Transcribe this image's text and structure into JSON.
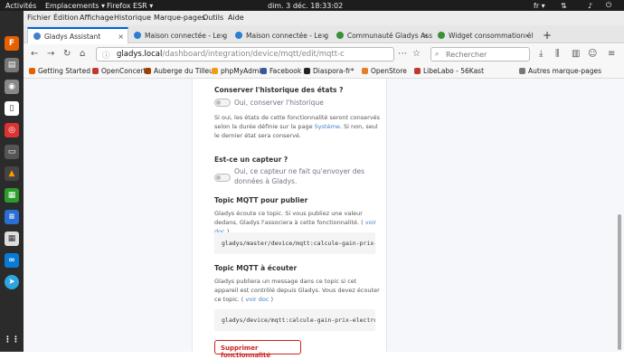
{
  "system": {
    "activities": "Activités",
    "places": "Emplacements ▾",
    "app": "Firefox ESR ▾",
    "clock": "dim. 3 déc. 18:33:02",
    "lang": "fr ▾"
  },
  "menu": [
    "Fichier",
    "Édition",
    "Affichage",
    "Historique",
    "Marque-pages",
    "Outils",
    "Aide"
  ],
  "tabs": [
    {
      "label": "Gladys Assistant",
      "active": true
    },
    {
      "label": "Maison connectée - Le g",
      "active": false
    },
    {
      "label": "Maison connectée - Le g",
      "active": false
    },
    {
      "label": "Communauté Gladys Ass",
      "active": false
    },
    {
      "label": "Widget consommation él",
      "active": false
    }
  ],
  "url": {
    "host": "gladys.local",
    "path": "/dashboard/integration/device/mqtt/edit/mqtt-c"
  },
  "search_placeholder": "Rechercher",
  "bookmarks": [
    {
      "label": "Getting Started",
      "color": "#e66000"
    },
    {
      "label": "OpenConcerto",
      "color": "#c0392b"
    },
    {
      "label": "Auberge du Tilleul",
      "color": "#a04000"
    },
    {
      "label": "phpMyAdmin",
      "color": "#f39c12"
    },
    {
      "label": "Facebook",
      "color": "#3b5998"
    },
    {
      "label": "Diaspora-fr*",
      "color": "#222"
    },
    {
      "label": "OpenStore",
      "color": "#e67e22"
    },
    {
      "label": "LibeLabo - 56Kast",
      "color": "#c0392b"
    },
    {
      "label": "Autres marque-pages",
      "color": "#777"
    }
  ],
  "form": {
    "history_title": "Conserver l'historique des états ?",
    "history_toggle": "Oui, conserver l'historique",
    "history_help_1": "Si oui, les états de cette fonctionnalité seront conservés selon la durée définie sur la page",
    "history_link": "Système",
    "history_help_2": ". Si non, seul le dernier état sera conservé.",
    "sensor_title": "Est-ce un capteur ?",
    "sensor_toggle": "Oui, ce capteur ne fait qu'envoyer des données à Gladys.",
    "publish_title": "Topic MQTT pour publier",
    "publish_help": "Gladys écoute ce topic. Si vous publiez une valeur dedans, Gladys l'associera à cette fonctionnalité. (",
    "publish_link": "voir doc",
    "publish_help_end": " )",
    "publish_topic": "gladys/master/device/mqtt:calcule-gain-prix-",
    "listen_title": "Topic MQTT à écouter",
    "listen_help": "Gladys publiera un message dans ce topic si cet appareil est contrôlé depuis Gladys. Vous devez écouter ce topic. (",
    "listen_link": "voir doc",
    "listen_help_end": " )",
    "listen_topic": "gladys/device/mqtt:calcule-gain-prix-electro",
    "delete_button": "Supprimer fonctionnalité"
  },
  "colors": {
    "accent": "#467fcf",
    "danger": "#cd201f"
  }
}
